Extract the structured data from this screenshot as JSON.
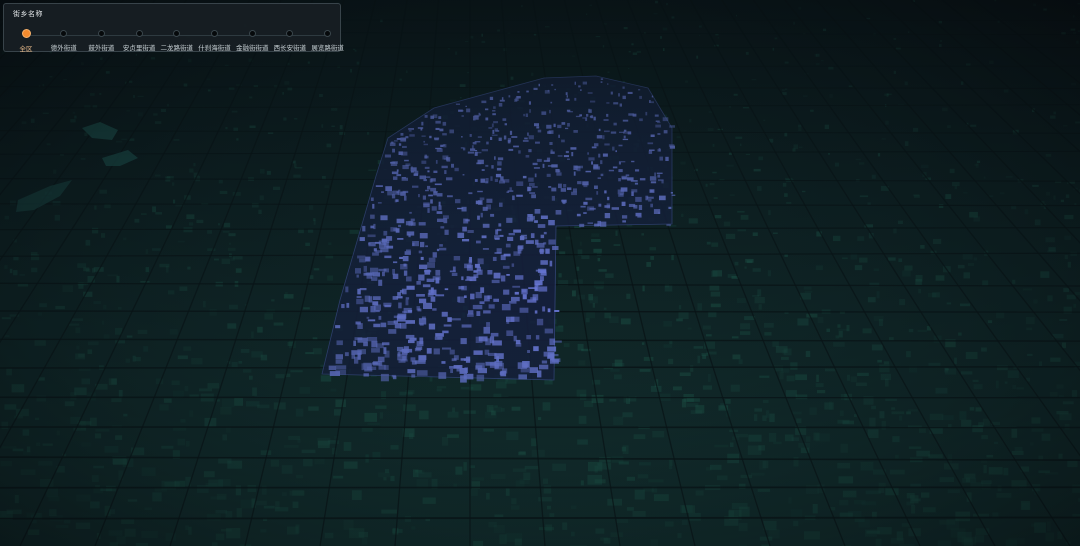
{
  "panel": {
    "title": "街乡名称",
    "selected_index": 0,
    "stops": [
      {
        "label": "全区"
      },
      {
        "label": "德外街道"
      },
      {
        "label": "鼓外街道"
      },
      {
        "label": "安贞里街道"
      },
      {
        "label": "二龙路街道"
      },
      {
        "label": "什刹海街道"
      },
      {
        "label": "金融街街道"
      },
      {
        "label": "西长安街道"
      },
      {
        "label": "展览路街道"
      }
    ]
  },
  "colors": {
    "background": "#0c1a1f",
    "terrain": "#1f5d4e",
    "highlight_district": "#6a78d8",
    "accent": "#f28a2e"
  }
}
